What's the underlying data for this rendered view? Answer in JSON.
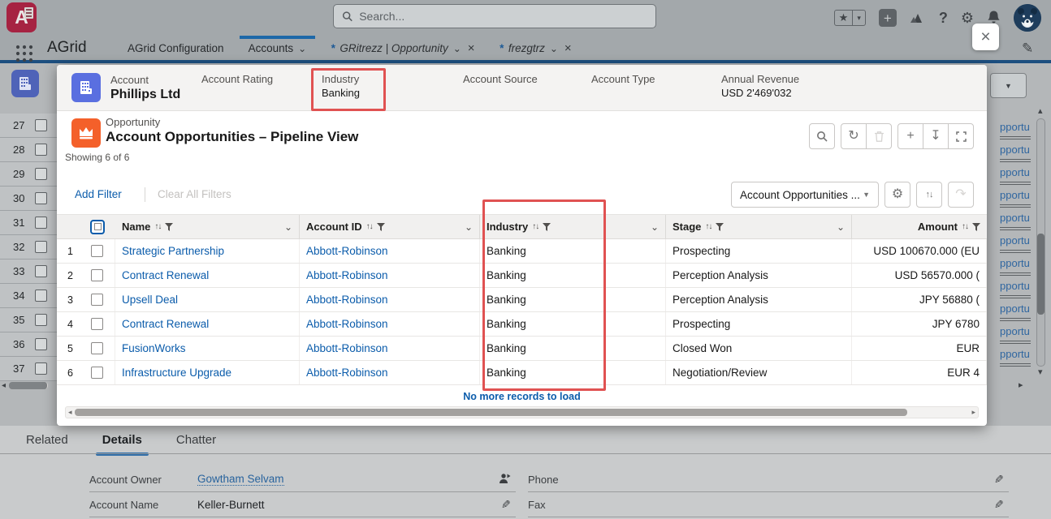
{
  "colors": {
    "accent_blue": "#0b5cab",
    "highlight_red": "#e05252",
    "account_icon": "#5a6fe0",
    "opportunity_icon": "#f4602a"
  },
  "topbar": {
    "search_placeholder": "Search..."
  },
  "nav": {
    "app_name": "AGrid",
    "tabs": [
      {
        "label": "AGrid Configuration",
        "active": false,
        "dirty": false,
        "italic": false,
        "chevron": false,
        "closable": false
      },
      {
        "label": "Accounts",
        "active": true,
        "dirty": false,
        "italic": false,
        "chevron": true,
        "closable": false
      },
      {
        "label": "GRitrezz | Opportunity",
        "active": false,
        "dirty": true,
        "italic": true,
        "chevron": true,
        "closable": true
      },
      {
        "label": "frezgtrz",
        "active": false,
        "dirty": true,
        "italic": true,
        "chevron": true,
        "closable": true
      }
    ]
  },
  "background": {
    "left_row_numbers": [
      "27",
      "28",
      "29",
      "30",
      "31",
      "32",
      "33",
      "34",
      "35",
      "36",
      "37"
    ],
    "right_link_label": "pportu",
    "right_link_count": 11
  },
  "modal": {
    "account_header": {
      "object_label": "Account",
      "name": "Phillips Ltd",
      "fields": [
        {
          "label": "Account Rating",
          "value": ""
        },
        {
          "label": "Industry",
          "value": "Banking"
        },
        {
          "label": "Account Source",
          "value": ""
        },
        {
          "label": "Account Type",
          "value": ""
        },
        {
          "label": "Annual Revenue",
          "value": "USD 2'469'032"
        }
      ]
    },
    "list_header": {
      "object_label": "Opportunity",
      "title": "Account Opportunities – Pipeline View",
      "showing": "Showing 6 of 6",
      "toolbar": [
        {
          "icon": "search",
          "disabled": false
        },
        {
          "icon": "refresh",
          "disabled": false
        },
        {
          "icon": "delete",
          "disabled": true
        },
        {
          "icon": "add",
          "disabled": false
        },
        {
          "icon": "download",
          "disabled": false
        },
        {
          "icon": "expand",
          "disabled": false
        }
      ]
    },
    "filter_bar": {
      "add_filter": "Add Filter",
      "clear_all": "Clear All Filters",
      "view_selector": "Account Opportunities ...",
      "buttons": [
        {
          "icon": "gear",
          "disabled": false
        },
        {
          "icon": "sort",
          "disabled": false
        },
        {
          "icon": "redo",
          "disabled": true
        }
      ]
    },
    "table": {
      "columns": [
        {
          "label": "Name",
          "menu": true
        },
        {
          "label": "Account ID",
          "menu": true
        },
        {
          "label": "Industry",
          "menu": true
        },
        {
          "label": "Stage",
          "menu": true
        },
        {
          "label": "Amount",
          "menu": false
        }
      ],
      "rows": [
        {
          "num": "1",
          "name": "Strategic Partnership",
          "account_id": "Abbott-Robinson",
          "industry": "Banking",
          "stage": "Prospecting",
          "amount": "USD 100670.000 (EU"
        },
        {
          "num": "2",
          "name": "Contract Renewal",
          "account_id": "Abbott-Robinson",
          "industry": "Banking",
          "stage": "Perception Analysis",
          "amount": "USD 56570.000 ("
        },
        {
          "num": "3",
          "name": "Upsell Deal",
          "account_id": "Abbott-Robinson",
          "industry": "Banking",
          "stage": "Perception Analysis",
          "amount": "JPY 56880 ("
        },
        {
          "num": "4",
          "name": "Contract Renewal",
          "account_id": "Abbott-Robinson",
          "industry": "Banking",
          "stage": "Prospecting",
          "amount": "JPY 6780"
        },
        {
          "num": "5",
          "name": "FusionWorks",
          "account_id": "Abbott-Robinson",
          "industry": "Banking",
          "stage": "Closed Won",
          "amount": "EUR"
        },
        {
          "num": "6",
          "name": "Infrastructure Upgrade",
          "account_id": "Abbott-Robinson",
          "industry": "Banking",
          "stage": "Negotiation/Review",
          "amount": "EUR 4"
        }
      ],
      "footer_message": "No more records to load"
    }
  },
  "details_panel": {
    "tabs": [
      {
        "label": "Related",
        "active": false
      },
      {
        "label": "Details",
        "active": true
      },
      {
        "label": "Chatter",
        "active": false
      }
    ],
    "left_fields": [
      {
        "label": "Account Owner",
        "value": "Gowtham Selvam",
        "is_link": true,
        "icon": "owner"
      },
      {
        "label": "Account Name",
        "value": "Keller-Burnett",
        "is_link": false,
        "icon": "pencil"
      }
    ],
    "right_fields": [
      {
        "label": "Phone",
        "value": "",
        "is_link": false,
        "icon": "pencil"
      },
      {
        "label": "Fax",
        "value": "",
        "is_link": false,
        "icon": "pencil"
      }
    ]
  }
}
